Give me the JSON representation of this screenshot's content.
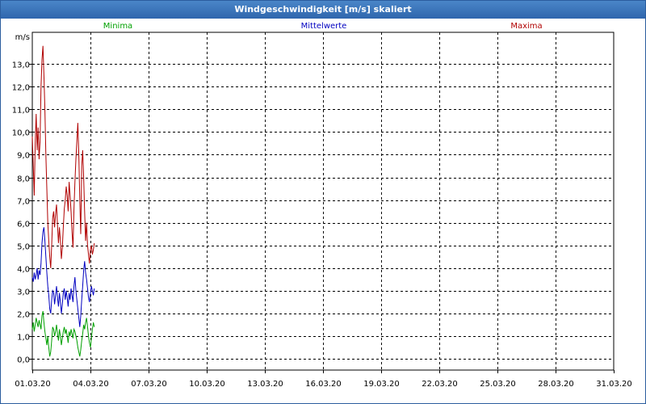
{
  "window": {
    "title": "Windgeschwindigkeit [m/s] skaliert"
  },
  "chart_data": {
    "type": "line",
    "title": "Windgeschwindigkeit [m/s] skaliert",
    "ylabel": "m/s",
    "xlabel": "",
    "ylim": [
      -0.5,
      14.4
    ],
    "xlim": [
      0,
      30
    ],
    "grid": true,
    "legend": "top",
    "yticks": [
      0,
      1,
      2,
      3,
      4,
      5,
      6,
      7,
      8,
      9,
      10,
      11,
      12,
      13
    ],
    "ytick_labels": [
      "0,0",
      "1,0",
      "2,0",
      "3,0",
      "4,0",
      "5,0",
      "6,0",
      "7,0",
      "8,0",
      "9,0",
      "10,0",
      "11,0",
      "12,0",
      "13,0"
    ],
    "xticks": [
      0,
      3,
      6,
      9,
      12,
      15,
      18,
      21,
      24,
      27,
      30
    ],
    "xtick_labels": [
      "01.03.20",
      "04.03.20",
      "07.03.20",
      "10.03.20",
      "13.03.20",
      "16.03.20",
      "19.03.20",
      "22.03.20",
      "25.03.20",
      "28.03.20",
      "31.03.20"
    ],
    "series": [
      {
        "name": "Minima",
        "color": "#00a000",
        "x": [
          0,
          0.05,
          0.1,
          0.15,
          0.2,
          0.25,
          0.3,
          0.35,
          0.4,
          0.45,
          0.5,
          0.55,
          0.6,
          0.65,
          0.7,
          0.75,
          0.8,
          0.85,
          0.9,
          0.95,
          1.0,
          1.05,
          1.1,
          1.15,
          1.2,
          1.25,
          1.3,
          1.35,
          1.4,
          1.45,
          1.5,
          1.55,
          1.6,
          1.65,
          1.7,
          1.75,
          1.8,
          1.85,
          1.9,
          1.95,
          2.0,
          2.05,
          2.1,
          2.15,
          2.2,
          2.25,
          2.3,
          2.35,
          2.4,
          2.45,
          2.5,
          2.55,
          2.6,
          2.65,
          2.7,
          2.75,
          2.8,
          2.85,
          2.9,
          2.95,
          3.0,
          3.05,
          3.1,
          3.15,
          3.2
        ],
        "y": [
          1.3,
          1.6,
          1.2,
          1.5,
          1.8,
          1.6,
          1.4,
          1.7,
          1.5,
          1.3,
          1.9,
          2.1,
          1.6,
          1.2,
          0.9,
          0.6,
          1.0,
          0.5,
          0.1,
          0.3,
          0.8,
          1.4,
          1.3,
          1.0,
          1.2,
          1.5,
          1.1,
          0.8,
          1.3,
          1.0,
          0.6,
          0.9,
          1.2,
          1.4,
          1.1,
          1.3,
          1.0,
          0.7,
          1.2,
          1.0,
          1.3,
          1.1,
          0.9,
          1.3,
          1.2,
          1.0,
          0.8,
          0.5,
          0.3,
          0.1,
          0.4,
          0.8,
          1.1,
          1.5,
          1.3,
          1.6,
          1.8,
          1.4,
          1.0,
          0.7,
          0.5,
          0.9,
          1.3,
          1.6,
          1.4
        ]
      },
      {
        "name": "Mittelwerte",
        "color": "#0000c0",
        "x": [
          0,
          0.05,
          0.1,
          0.15,
          0.2,
          0.25,
          0.3,
          0.35,
          0.4,
          0.45,
          0.5,
          0.55,
          0.6,
          0.65,
          0.7,
          0.75,
          0.8,
          0.85,
          0.9,
          0.95,
          1.0,
          1.05,
          1.1,
          1.15,
          1.2,
          1.25,
          1.3,
          1.35,
          1.4,
          1.45,
          1.5,
          1.55,
          1.6,
          1.65,
          1.7,
          1.75,
          1.8,
          1.85,
          1.9,
          1.95,
          2.0,
          2.05,
          2.1,
          2.15,
          2.2,
          2.25,
          2.3,
          2.35,
          2.4,
          2.45,
          2.5,
          2.55,
          2.6,
          2.65,
          2.7,
          2.75,
          2.8,
          2.85,
          2.9,
          2.95,
          3.0,
          3.05,
          3.1,
          3.15,
          3.2
        ],
        "y": [
          3.6,
          3.4,
          3.8,
          3.5,
          3.7,
          4.0,
          3.5,
          3.9,
          3.7,
          4.2,
          5.1,
          5.6,
          5.8,
          5.2,
          4.5,
          3.8,
          3.2,
          2.8,
          2.2,
          2.0,
          2.6,
          3.0,
          2.9,
          2.4,
          2.8,
          3.2,
          2.7,
          2.3,
          2.9,
          2.5,
          2.0,
          2.4,
          2.9,
          3.1,
          2.6,
          3.0,
          2.7,
          2.3,
          2.9,
          2.6,
          3.1,
          2.8,
          2.5,
          3.2,
          3.6,
          3.0,
          2.6,
          2.2,
          1.8,
          1.4,
          1.9,
          2.6,
          3.2,
          3.9,
          4.3,
          3.8,
          3.5,
          3.1,
          2.7,
          2.5,
          2.9,
          3.2,
          3.0,
          2.8,
          3.1
        ]
      },
      {
        "name": "Maxima",
        "color": "#b00000",
        "x": [
          0,
          0.05,
          0.1,
          0.15,
          0.2,
          0.25,
          0.3,
          0.35,
          0.4,
          0.45,
          0.5,
          0.55,
          0.6,
          0.65,
          0.7,
          0.75,
          0.8,
          0.85,
          0.9,
          0.95,
          1.0,
          1.05,
          1.1,
          1.15,
          1.2,
          1.25,
          1.3,
          1.35,
          1.4,
          1.45,
          1.5,
          1.55,
          1.6,
          1.65,
          1.7,
          1.75,
          1.8,
          1.85,
          1.9,
          1.95,
          2.0,
          2.05,
          2.1,
          2.15,
          2.2,
          2.25,
          2.3,
          2.35,
          2.4,
          2.45,
          2.5,
          2.55,
          2.6,
          2.65,
          2.7,
          2.75,
          2.8,
          2.85,
          2.9,
          2.95,
          3.0,
          3.05,
          3.1,
          3.15,
          3.2
        ],
        "y": [
          9.8,
          8.5,
          7.2,
          9.5,
          10.8,
          9.2,
          10.2,
          8.8,
          9.6,
          12.0,
          13.2,
          13.8,
          12.5,
          11.0,
          9.0,
          7.5,
          6.0,
          5.2,
          4.5,
          4.0,
          5.0,
          6.2,
          6.5,
          5.8,
          6.4,
          6.8,
          5.9,
          5.1,
          5.8,
          5.2,
          4.4,
          4.9,
          5.8,
          6.6,
          7.0,
          7.6,
          7.2,
          6.5,
          7.8,
          7.2,
          6.5,
          5.6,
          4.9,
          6.6,
          7.8,
          8.8,
          9.6,
          10.4,
          9.0,
          7.0,
          5.5,
          8.5,
          9.2,
          8.0,
          6.5,
          5.2,
          6.0,
          5.0,
          4.6,
          4.2,
          4.8,
          5.0,
          4.6,
          4.8,
          5.1
        ]
      }
    ]
  }
}
